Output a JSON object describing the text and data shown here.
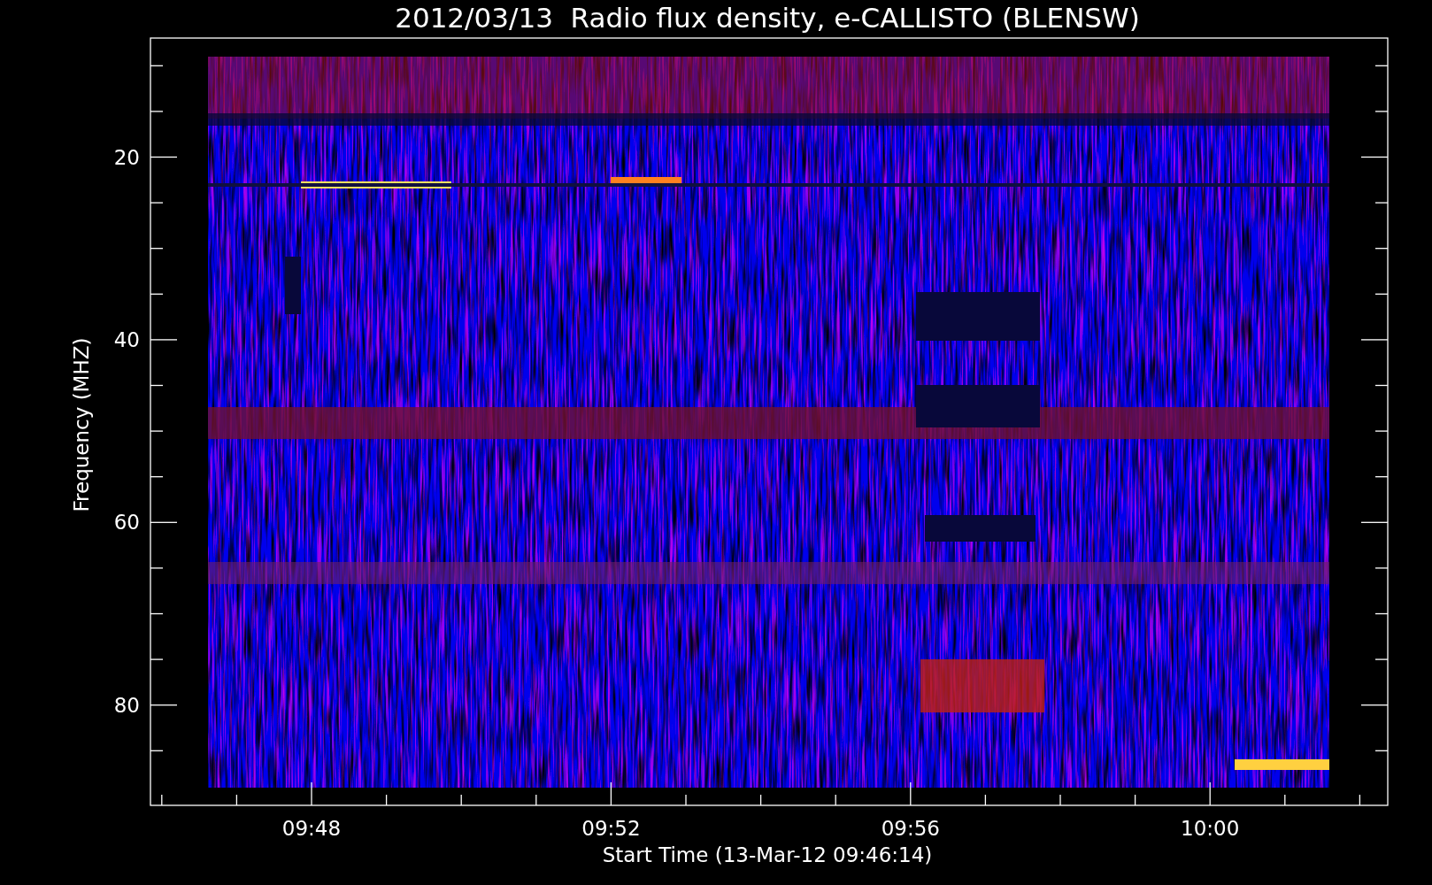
{
  "title": "2012/03/13  Radio flux density, e-CALLISTO (BLENSW)",
  "y_axis": {
    "label": "Frequency (MHZ)",
    "ticks": [
      "20",
      "40",
      "60",
      "80"
    ]
  },
  "x_axis": {
    "label": "Start Time (13-Mar-12 09:46:14)",
    "ticks": [
      "09:48",
      "09:52",
      "09:56",
      "10:00"
    ]
  }
}
